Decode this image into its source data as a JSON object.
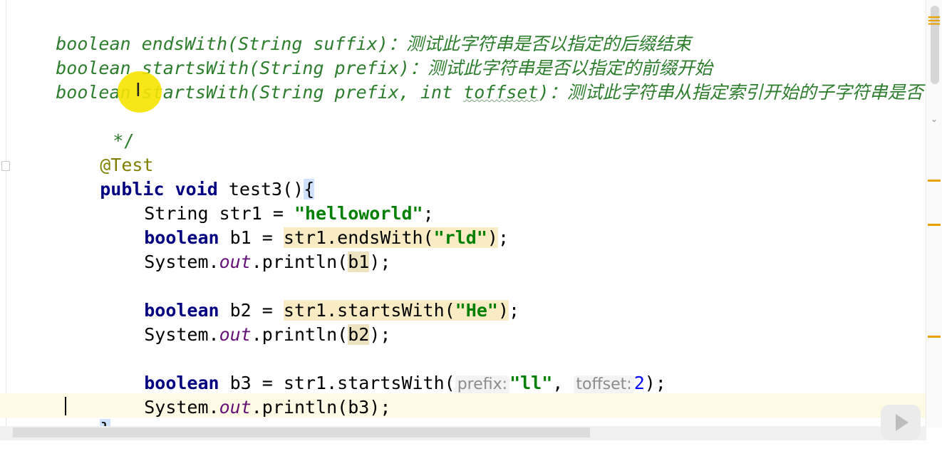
{
  "comment_lines": [
    {
      "sig": "boolean endsWith(String suffix)",
      "desc": "：测试此字符串是否以指定的后缀结束"
    },
    {
      "sig": "boolean startsWith(String prefix)",
      "desc": "：测试此字符串是否以指定的前缀开始"
    },
    {
      "sig_pre": "boolean startsWith(String prefix, int ",
      "sig_param": "toffset",
      "sig_post": ")",
      "desc": "：测试此字符串从指定索引开始的子字符串是否"
    }
  ],
  "comment_end": "*/",
  "annotation": "@Test",
  "method": {
    "kw": "public void",
    "name": " test3()",
    "brace_open": "{",
    "brace_close": "}"
  },
  "body": {
    "l1": {
      "type": "String",
      "decl": " str1 = ",
      "value": "\"helloworld\"",
      "end": ";"
    },
    "l2": {
      "kw": "boolean",
      "decl": " b1 = ",
      "call": "str1.endsWith(",
      "arg": "\"rld\"",
      "close": ")",
      "end": ";"
    },
    "l3": {
      "pre": "System.",
      "field": "out",
      "post": ".println(",
      "var": "b1",
      "end": ");"
    },
    "l4": {
      "kw": "boolean",
      "decl": " b2 = ",
      "call": "str1.startsWith(",
      "arg": "\"He\"",
      "close": ")",
      "end": ";"
    },
    "l5": {
      "pre": "System.",
      "field": "out",
      "post": ".println(",
      "var": "b2",
      "end": ");"
    },
    "l6": {
      "kw": "boolean",
      "decl": " b3 = str1.startsWith(",
      "hint1": "prefix:",
      "arg1": "\"ll\"",
      "sep": ", ",
      "hint2": "toffset:",
      "arg2": "2",
      "end": ");"
    },
    "l7": {
      "pre": "System.",
      "field": "out",
      "post": ".println(b3);"
    }
  },
  "icons": {
    "menu": "≡",
    "cursor": "I",
    "chevron": "⌄"
  },
  "colors": {
    "comment": "#2c7d2c",
    "keyword": "#000080",
    "string": "#008000",
    "annotation": "#808000",
    "marker": "#e8a200"
  }
}
